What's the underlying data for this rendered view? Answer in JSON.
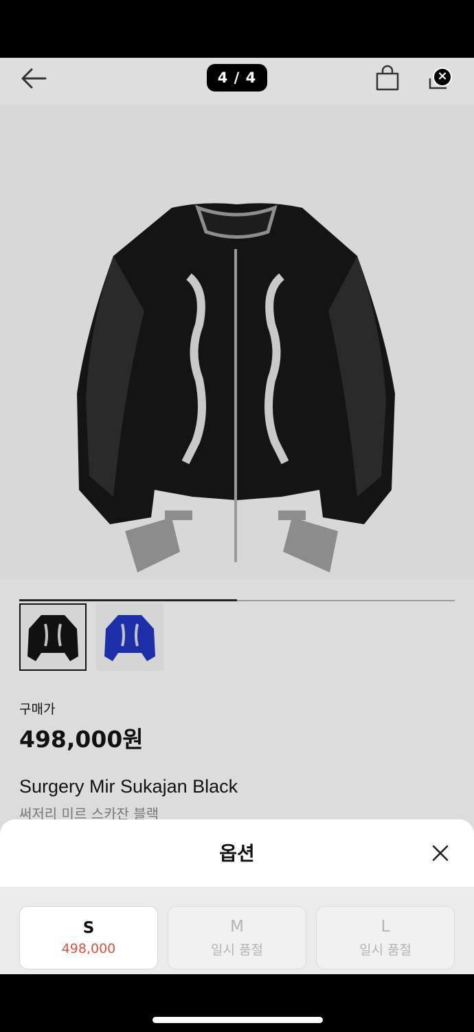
{
  "nav": {
    "counter": "4 / 4"
  },
  "gallery": {
    "current": 4,
    "total": 4,
    "progress_fraction": 0.5,
    "thumbnails": [
      {
        "color": "black",
        "selected": true
      },
      {
        "color": "blue",
        "selected": false
      }
    ]
  },
  "product": {
    "price_label": "구매가",
    "price": "498,000원",
    "name": "Surgery Mir Sukajan Black",
    "name_ko": "써저리 미르 스카잔 블랙"
  },
  "sheet": {
    "title": "옵션",
    "options": [
      {
        "size": "S",
        "sub": "498,000",
        "available": true
      },
      {
        "size": "M",
        "sub": "일시 품절",
        "available": false
      },
      {
        "size": "L",
        "sub": "일시 품절",
        "available": false
      }
    ]
  },
  "colors": {
    "accent_price": "#e0503a",
    "background": "#dcdcdc"
  }
}
